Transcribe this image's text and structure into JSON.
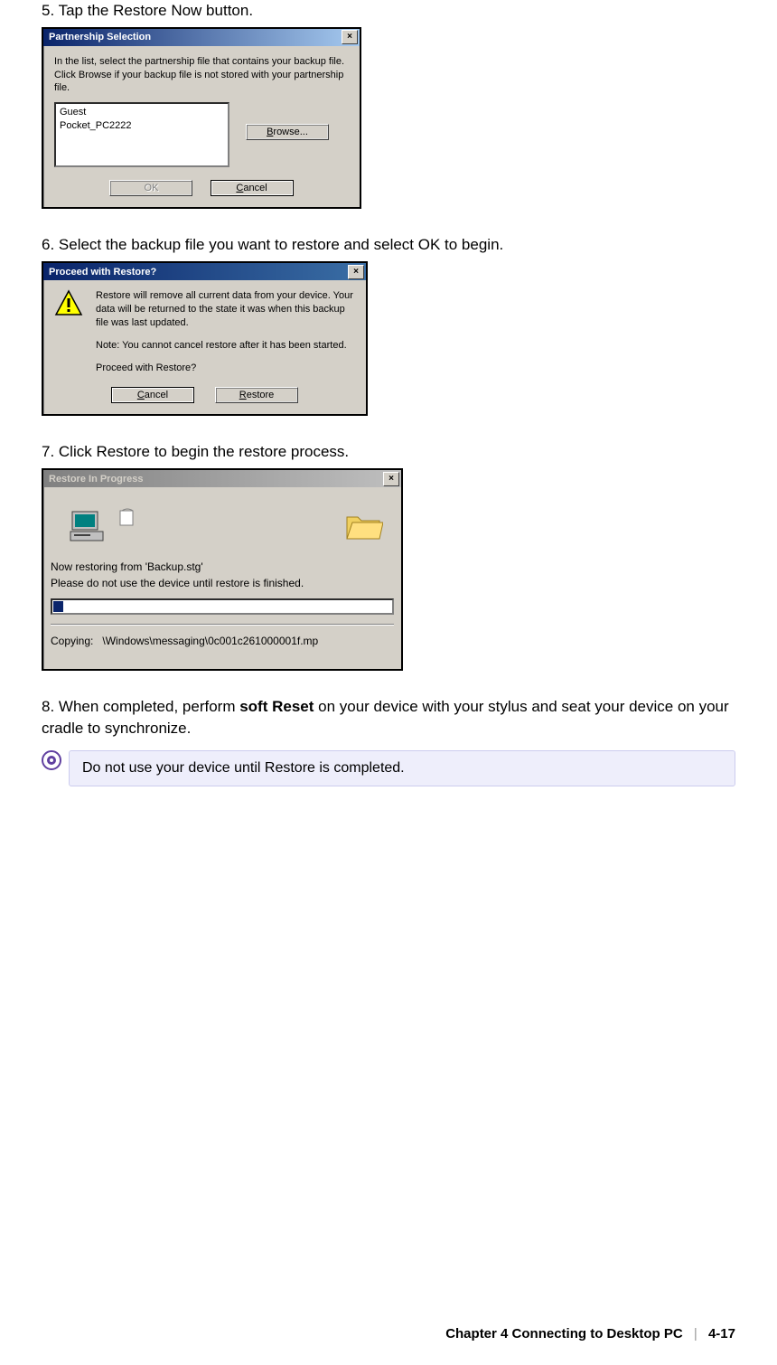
{
  "steps": {
    "s5": "5. Tap the Restore Now button.",
    "s6": "6. Select the backup file you want to restore and select OK to begin.",
    "s7": "7. Click Restore to begin the restore process.",
    "s8_a": "8. When completed, perform ",
    "s8_b": "soft Reset",
    "s8_c": " on your device with your stylus and seat your device on your cradle to synchronize."
  },
  "dialog1": {
    "title": "Partnership Selection",
    "instruction": "In the list, select the partnership file that contains your backup file.  Click Browse if your backup file is not stored with your partnership file.",
    "list_items": [
      "Guest",
      "Pocket_PC2222"
    ],
    "browse": "Browse...",
    "ok": "OK",
    "cancel": "Cancel"
  },
  "dialog2": {
    "title": "Proceed with Restore?",
    "msg1": "Restore will remove all current data from your device. Your data will be returned to the state it was when this backup file was last updated.",
    "msg2": "Note: You cannot cancel restore after it has been started.",
    "msg3": "Proceed with Restore?",
    "cancel": "Cancel",
    "restore": "Restore"
  },
  "dialog3": {
    "title": "Restore In Progress",
    "line1": "Now restoring from 'Backup.stg'",
    "line2": "Please do not use the device until restore is finished.",
    "copying_label": "Copying:",
    "copying_path": "\\Windows\\messaging\\0c001c261000001f.mp"
  },
  "note": "Do not use your device until Restore is completed.",
  "footer": {
    "chapter": "Chapter 4    Connecting to Desktop PC",
    "page": "4-17"
  }
}
